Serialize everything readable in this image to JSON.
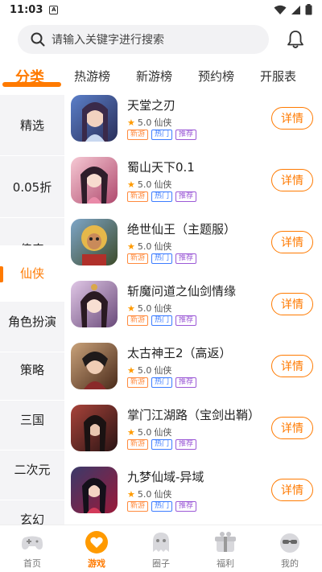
{
  "status_bar": {
    "time": "11:03",
    "app_indicator": "A"
  },
  "search": {
    "placeholder": "请输入关键字进行搜索"
  },
  "tabs": [
    "分类",
    "热游榜",
    "新游榜",
    "预约榜",
    "开服表"
  ],
  "sidebar": [
    "精选",
    "0.05折",
    "传奇",
    "仙侠",
    "角色扮演",
    "策略",
    "三国",
    "二次元",
    "玄幻"
  ],
  "detail_label": "详情",
  "games": [
    {
      "name": "天堂之刃",
      "rating": "5.0",
      "genre": "仙侠",
      "tags": [
        "新游",
        "热门",
        "推荐"
      ]
    },
    {
      "name": "蜀山天下0.1",
      "rating": "5.0",
      "genre": "仙侠",
      "tags": [
        "新游",
        "热门",
        "推荐"
      ]
    },
    {
      "name": "绝世仙王（主题服）",
      "rating": "5.0",
      "genre": "仙侠",
      "tags": [
        "新游",
        "热门",
        "推荐"
      ]
    },
    {
      "name": "斩魔问道之仙剑情缘",
      "rating": "5.0",
      "genre": "仙侠",
      "tags": [
        "新游",
        "热门",
        "推荐"
      ]
    },
    {
      "name": "太古神王2（高返）",
      "rating": "5.0",
      "genre": "仙侠",
      "tags": [
        "新游",
        "热门",
        "推荐"
      ]
    },
    {
      "name": "掌门江湖路（宝剑出鞘）",
      "rating": "5.0",
      "genre": "仙侠",
      "tags": [
        "新游",
        "热门",
        "推荐"
      ]
    },
    {
      "name": "九梦仙域-异域",
      "rating": "5.0",
      "genre": "仙侠",
      "tags": [
        "新游",
        "热门",
        "推荐"
      ]
    }
  ],
  "bottom_nav": [
    "首页",
    "游戏",
    "圈子",
    "福利",
    "我的"
  ],
  "colors": {
    "accent": "#ff7a00",
    "sidebar_bg": "#f4f4f6",
    "tag_new": "#ff8a3d",
    "tag_hot": "#3d7cff",
    "tag_rec": "#9b59d6"
  }
}
